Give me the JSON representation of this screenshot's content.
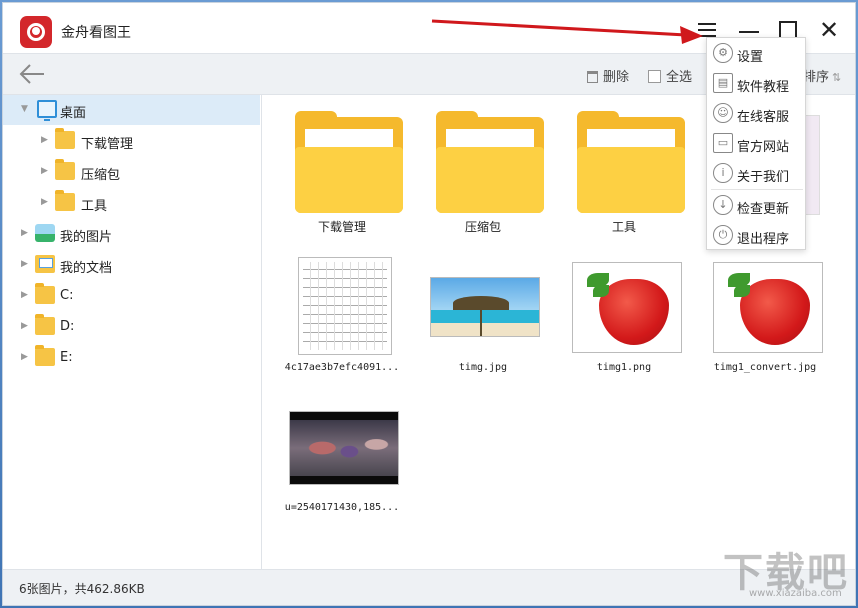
{
  "app": {
    "title": "金舟看图王"
  },
  "toolbar": {
    "delete_label": "删除",
    "select_all_label": "全选",
    "sort_label": "排序"
  },
  "sidebar": {
    "items": [
      {
        "label": "桌面",
        "icon": "desktop-icon",
        "selected": true
      },
      {
        "label": "下载管理",
        "icon": "folder-icon"
      },
      {
        "label": "压缩包",
        "icon": "folder-icon"
      },
      {
        "label": "工具",
        "icon": "folder-icon"
      },
      {
        "label": "我的图片",
        "icon": "pictures-icon"
      },
      {
        "label": "我的文档",
        "icon": "documents-icon"
      },
      {
        "label": "C:",
        "icon": "drive-icon"
      },
      {
        "label": "D:",
        "icon": "drive-icon"
      },
      {
        "label": "E:",
        "icon": "drive-icon"
      }
    ]
  },
  "content": {
    "items": [
      {
        "name": "下载管理",
        "type": "folder"
      },
      {
        "name": "压缩包",
        "type": "folder"
      },
      {
        "name": "工具",
        "type": "folder"
      },
      {
        "name": "4c17ae3b7efc4091...",
        "type": "image"
      },
      {
        "name": "timg.jpg",
        "type": "image"
      },
      {
        "name": "timg1.png",
        "type": "image"
      },
      {
        "name": "timg1_convert.jpg",
        "type": "image"
      },
      {
        "name": "u=2540171430,185...",
        "type": "image"
      }
    ]
  },
  "menu": {
    "items": [
      {
        "label": "设置",
        "icon": "gear-icon"
      },
      {
        "label": "软件教程",
        "icon": "book-icon"
      },
      {
        "label": "在线客服",
        "icon": "headset-icon"
      },
      {
        "label": "官方网站",
        "icon": "monitor-icon"
      },
      {
        "label": "关于我们",
        "icon": "info-icon"
      },
      {
        "label": "检查更新",
        "icon": "download-icon"
      },
      {
        "label": "退出程序",
        "icon": "power-icon"
      }
    ]
  },
  "status": {
    "text": "6张图片，共462.86KB"
  },
  "watermark": {
    "big": "下载吧",
    "small": "www.xiazaiba.com"
  },
  "colors": {
    "accent": "#2f8fd8",
    "folder": "#f5b92d",
    "logo": "#d3272b",
    "arrow": "#d0181c",
    "selected_bg": "#dcebf8"
  }
}
